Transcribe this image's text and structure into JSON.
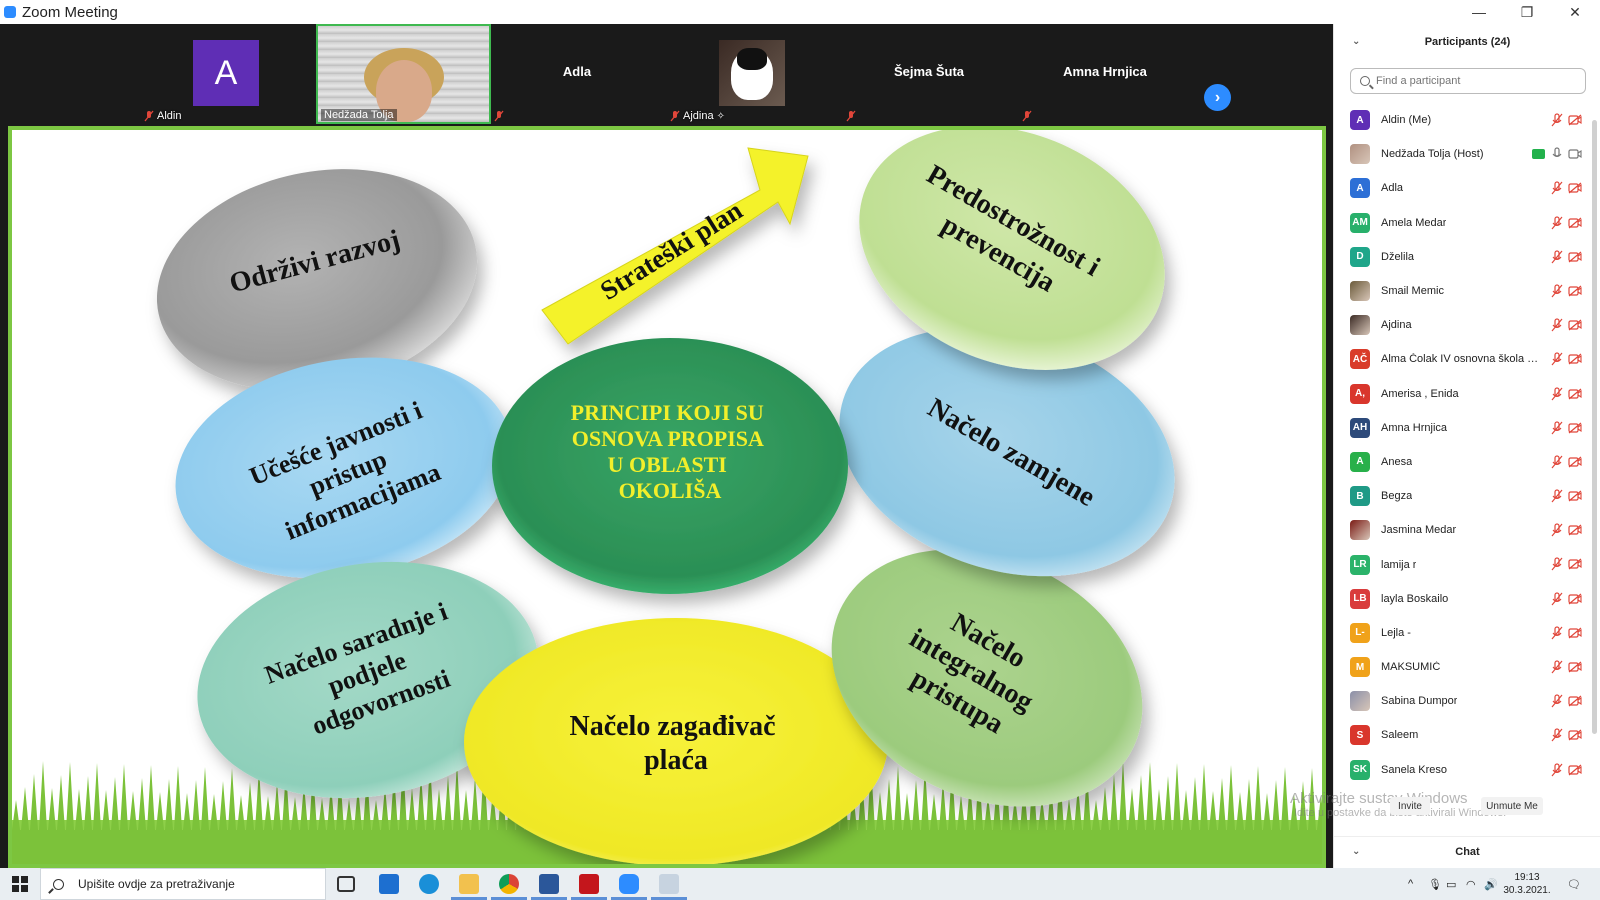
{
  "window": {
    "title": "Zoom Meeting",
    "minimize": "—",
    "restore": "❐",
    "close": "✕"
  },
  "video_strip": {
    "tiles": [
      {
        "name": "Aldin",
        "avatar_letter": "A"
      },
      {
        "name": "Nedžada Tolja"
      },
      {
        "name": "Adla"
      },
      {
        "name": "Ajdina"
      },
      {
        "name": "Šejma Šuta"
      },
      {
        "name": "Amna Hrnjica"
      }
    ],
    "next_symbol": "›"
  },
  "slide": {
    "center": [
      "PRINCIPI KOJI SU",
      "OSNOVA PROPISA",
      "U OBLASTI",
      "OKOLIŠA"
    ],
    "arrow_label": "Strateški plan",
    "ellipses": {
      "odrzivi": [
        "Održivi razvoj"
      ],
      "ucesce": [
        "Učešće javnosti  i",
        "pristup",
        "informacijama"
      ],
      "saradnja": [
        "Načelo saradnje i",
        "podjele",
        "odgovornosti"
      ],
      "zagadjivac": [
        "Načelo zagađivač",
        "plaća"
      ],
      "integralnog": [
        "Načelo",
        "integralnog",
        "pristupa"
      ],
      "zamjene": [
        "Načelo zamjene"
      ],
      "predostroznost": [
        "Predostrožnost i",
        "prevencija"
      ]
    },
    "colors": {
      "border": "#7dc743",
      "center_fill": "#2f9a5c",
      "center_text": "#f2ef2b",
      "arrow": "#f4f22a",
      "grass": "#8dcf49"
    }
  },
  "participants": {
    "header": "Participants (24)",
    "search_placeholder": "Find a participant",
    "list": [
      {
        "name": "Aldin (Me)",
        "initials": "A",
        "color": "#5f2eb5",
        "photo": false,
        "host": false
      },
      {
        "name": "Nedžada Tolja (Host)",
        "initials": "",
        "color": "#b09080",
        "photo": true,
        "host": true
      },
      {
        "name": "Adla",
        "initials": "A",
        "color": "#2d6fd6",
        "photo": false,
        "host": false
      },
      {
        "name": "Amela Medar",
        "initials": "AM",
        "color": "#28b06b",
        "photo": false,
        "host": false
      },
      {
        "name": "Dželila",
        "initials": "D",
        "color": "#1fa68a",
        "photo": false,
        "host": false
      },
      {
        "name": "Smail Memic",
        "initials": "",
        "color": "#6a5a3a",
        "photo": true,
        "host": false
      },
      {
        "name": "Ajdina",
        "initials": "",
        "color": "#3a2a24",
        "photo": true,
        "host": false
      },
      {
        "name": "Alma Čolak IV osnovna škola M...",
        "initials": "AČ",
        "color": "#d93c2a",
        "photo": false,
        "host": false
      },
      {
        "name": "Amerisa , Enida",
        "initials": "A,",
        "color": "#d9362c",
        "photo": false,
        "host": false
      },
      {
        "name": "Amna Hrnjica",
        "initials": "AH",
        "color": "#2d4a7a",
        "photo": false,
        "host": false
      },
      {
        "name": "Anesa",
        "initials": "A",
        "color": "#28b04a",
        "photo": false,
        "host": false
      },
      {
        "name": "Begza",
        "initials": "B",
        "color": "#1f9a86",
        "photo": false,
        "host": false
      },
      {
        "name": "Jasmina Medar",
        "initials": "",
        "color": "#7a1a14",
        "photo": true,
        "host": false
      },
      {
        "name": "lamija r",
        "initials": "LR",
        "color": "#2bb36a",
        "photo": false,
        "host": false
      },
      {
        "name": "layla Boskailo",
        "initials": "LB",
        "color": "#d93c3c",
        "photo": false,
        "host": false
      },
      {
        "name": "Lejla -",
        "initials": "L-",
        "color": "#f0a21a",
        "photo": false,
        "host": false
      },
      {
        "name": "MAKSUMIĆ",
        "initials": "M",
        "color": "#f0a21a",
        "photo": false,
        "host": false
      },
      {
        "name": "Sabina Dumpor",
        "initials": "",
        "color": "#8a8fa8",
        "photo": true,
        "host": false
      },
      {
        "name": "Saleem",
        "initials": "S",
        "color": "#d9362c",
        "photo": false,
        "host": false
      },
      {
        "name": "Sanela Kreso",
        "initials": "SK",
        "color": "#28b06b",
        "photo": false,
        "host": false
      }
    ],
    "invite_label": "Invite",
    "unmute_label": "Unmute Me",
    "watermark_line1": "Aktivirajte sustav Windows",
    "watermark_line2": "Idite u postavke da biste aktivirali Windows.",
    "chat_header": "Chat"
  },
  "taskbar": {
    "search_text": "Upišite ovdje za pretraživanje",
    "time": "19:13",
    "date": "30.3.2021."
  }
}
